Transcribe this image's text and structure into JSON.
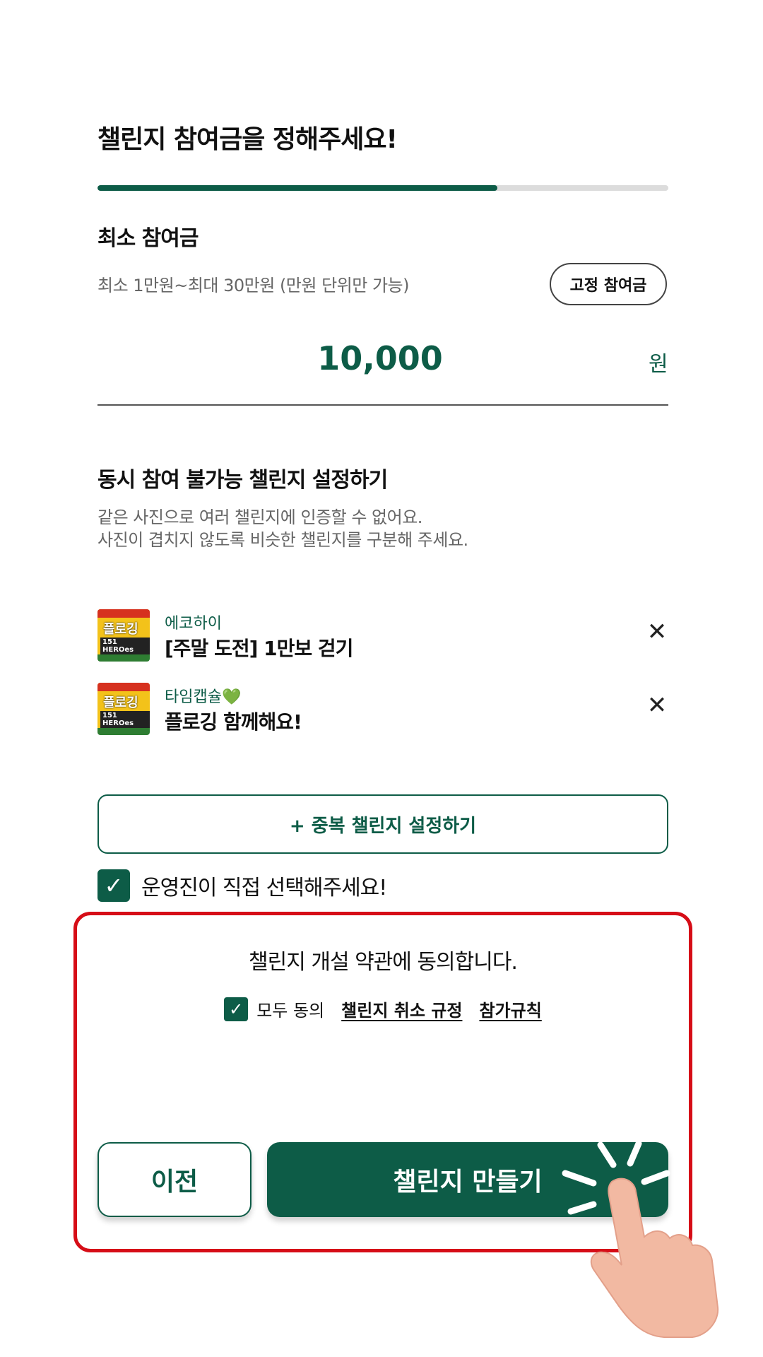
{
  "header": {
    "title": "챌린지 참여금을 정해주세요!",
    "progress_percent": 70
  },
  "min_fee": {
    "title": "최소 참여금",
    "description": "최소 1만원~최대 30만원 (만원 단위만 가능)",
    "fixed_button": "고정 참여금",
    "amount": "10,000",
    "unit": "원"
  },
  "conflict": {
    "title": "동시 참여 불가능 챌린지 설정하기",
    "desc_line1": "같은 사진으로 여러 챌린지에 인증할 수 없어요.",
    "desc_line2": "사진이 겹치지 않도록 비슷한 챌린지를 구분해 주세요.",
    "items": [
      {
        "org": "에코하이",
        "name": "[주말 도전] 1만보 걷기",
        "thumb_title": "플로깅",
        "thumb_sub": "151 HEROes"
      },
      {
        "org": "타임캡슐💚",
        "name": "플로깅 함께해요!",
        "thumb_title": "플로깅",
        "thumb_sub": "151 HEROes"
      }
    ],
    "add_button": "+ 중복 챌린지 설정하기",
    "operator_check": "운영진이 직접 선택해주세요!"
  },
  "terms": {
    "text": "챌린지 개설 약관에 동의합니다.",
    "agree_all": "모두 동의",
    "link_cancel": "챌린지 취소 규정",
    "link_rules": "참가규칙"
  },
  "footer": {
    "prev": "이전",
    "make": "챌린지 만들기"
  },
  "colors": {
    "accent": "#0d5c47",
    "highlight": "#d60d17"
  }
}
